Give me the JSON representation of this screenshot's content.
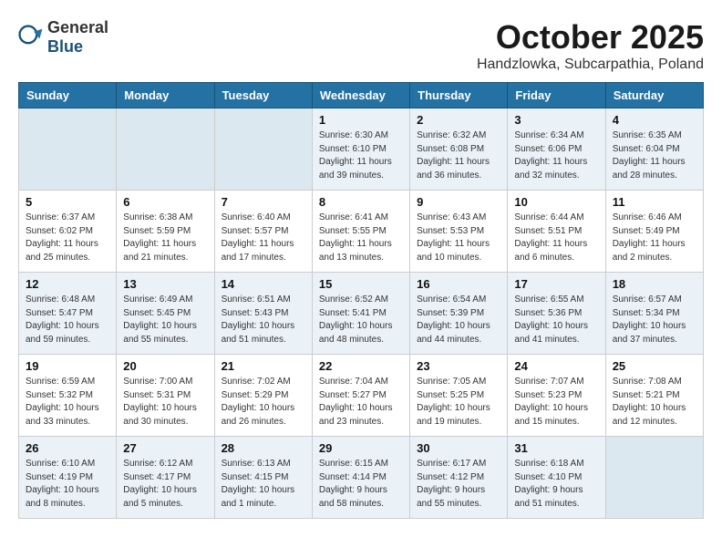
{
  "header": {
    "logo_general": "General",
    "logo_blue": "Blue",
    "month_title": "October 2025",
    "location": "Handzlowka, Subcarpathia, Poland"
  },
  "weekdays": [
    "Sunday",
    "Monday",
    "Tuesday",
    "Wednesday",
    "Thursday",
    "Friday",
    "Saturday"
  ],
  "weeks": [
    [
      {
        "day": "",
        "text": ""
      },
      {
        "day": "",
        "text": ""
      },
      {
        "day": "",
        "text": ""
      },
      {
        "day": "1",
        "text": "Sunrise: 6:30 AM\nSunset: 6:10 PM\nDaylight: 11 hours\nand 39 minutes."
      },
      {
        "day": "2",
        "text": "Sunrise: 6:32 AM\nSunset: 6:08 PM\nDaylight: 11 hours\nand 36 minutes."
      },
      {
        "day": "3",
        "text": "Sunrise: 6:34 AM\nSunset: 6:06 PM\nDaylight: 11 hours\nand 32 minutes."
      },
      {
        "day": "4",
        "text": "Sunrise: 6:35 AM\nSunset: 6:04 PM\nDaylight: 11 hours\nand 28 minutes."
      }
    ],
    [
      {
        "day": "5",
        "text": "Sunrise: 6:37 AM\nSunset: 6:02 PM\nDaylight: 11 hours\nand 25 minutes."
      },
      {
        "day": "6",
        "text": "Sunrise: 6:38 AM\nSunset: 5:59 PM\nDaylight: 11 hours\nand 21 minutes."
      },
      {
        "day": "7",
        "text": "Sunrise: 6:40 AM\nSunset: 5:57 PM\nDaylight: 11 hours\nand 17 minutes."
      },
      {
        "day": "8",
        "text": "Sunrise: 6:41 AM\nSunset: 5:55 PM\nDaylight: 11 hours\nand 13 minutes."
      },
      {
        "day": "9",
        "text": "Sunrise: 6:43 AM\nSunset: 5:53 PM\nDaylight: 11 hours\nand 10 minutes."
      },
      {
        "day": "10",
        "text": "Sunrise: 6:44 AM\nSunset: 5:51 PM\nDaylight: 11 hours\nand 6 minutes."
      },
      {
        "day": "11",
        "text": "Sunrise: 6:46 AM\nSunset: 5:49 PM\nDaylight: 11 hours\nand 2 minutes."
      }
    ],
    [
      {
        "day": "12",
        "text": "Sunrise: 6:48 AM\nSunset: 5:47 PM\nDaylight: 10 hours\nand 59 minutes."
      },
      {
        "day": "13",
        "text": "Sunrise: 6:49 AM\nSunset: 5:45 PM\nDaylight: 10 hours\nand 55 minutes."
      },
      {
        "day": "14",
        "text": "Sunrise: 6:51 AM\nSunset: 5:43 PM\nDaylight: 10 hours\nand 51 minutes."
      },
      {
        "day": "15",
        "text": "Sunrise: 6:52 AM\nSunset: 5:41 PM\nDaylight: 10 hours\nand 48 minutes."
      },
      {
        "day": "16",
        "text": "Sunrise: 6:54 AM\nSunset: 5:39 PM\nDaylight: 10 hours\nand 44 minutes."
      },
      {
        "day": "17",
        "text": "Sunrise: 6:55 AM\nSunset: 5:36 PM\nDaylight: 10 hours\nand 41 minutes."
      },
      {
        "day": "18",
        "text": "Sunrise: 6:57 AM\nSunset: 5:34 PM\nDaylight: 10 hours\nand 37 minutes."
      }
    ],
    [
      {
        "day": "19",
        "text": "Sunrise: 6:59 AM\nSunset: 5:32 PM\nDaylight: 10 hours\nand 33 minutes."
      },
      {
        "day": "20",
        "text": "Sunrise: 7:00 AM\nSunset: 5:31 PM\nDaylight: 10 hours\nand 30 minutes."
      },
      {
        "day": "21",
        "text": "Sunrise: 7:02 AM\nSunset: 5:29 PM\nDaylight: 10 hours\nand 26 minutes."
      },
      {
        "day": "22",
        "text": "Sunrise: 7:04 AM\nSunset: 5:27 PM\nDaylight: 10 hours\nand 23 minutes."
      },
      {
        "day": "23",
        "text": "Sunrise: 7:05 AM\nSunset: 5:25 PM\nDaylight: 10 hours\nand 19 minutes."
      },
      {
        "day": "24",
        "text": "Sunrise: 7:07 AM\nSunset: 5:23 PM\nDaylight: 10 hours\nand 15 minutes."
      },
      {
        "day": "25",
        "text": "Sunrise: 7:08 AM\nSunset: 5:21 PM\nDaylight: 10 hours\nand 12 minutes."
      }
    ],
    [
      {
        "day": "26",
        "text": "Sunrise: 6:10 AM\nSunset: 4:19 PM\nDaylight: 10 hours\nand 8 minutes."
      },
      {
        "day": "27",
        "text": "Sunrise: 6:12 AM\nSunset: 4:17 PM\nDaylight: 10 hours\nand 5 minutes."
      },
      {
        "day": "28",
        "text": "Sunrise: 6:13 AM\nSunset: 4:15 PM\nDaylight: 10 hours\nand 1 minute."
      },
      {
        "day": "29",
        "text": "Sunrise: 6:15 AM\nSunset: 4:14 PM\nDaylight: 9 hours\nand 58 minutes."
      },
      {
        "day": "30",
        "text": "Sunrise: 6:17 AM\nSunset: 4:12 PM\nDaylight: 9 hours\nand 55 minutes."
      },
      {
        "day": "31",
        "text": "Sunrise: 6:18 AM\nSunset: 4:10 PM\nDaylight: 9 hours\nand 51 minutes."
      },
      {
        "day": "",
        "text": ""
      }
    ]
  ]
}
